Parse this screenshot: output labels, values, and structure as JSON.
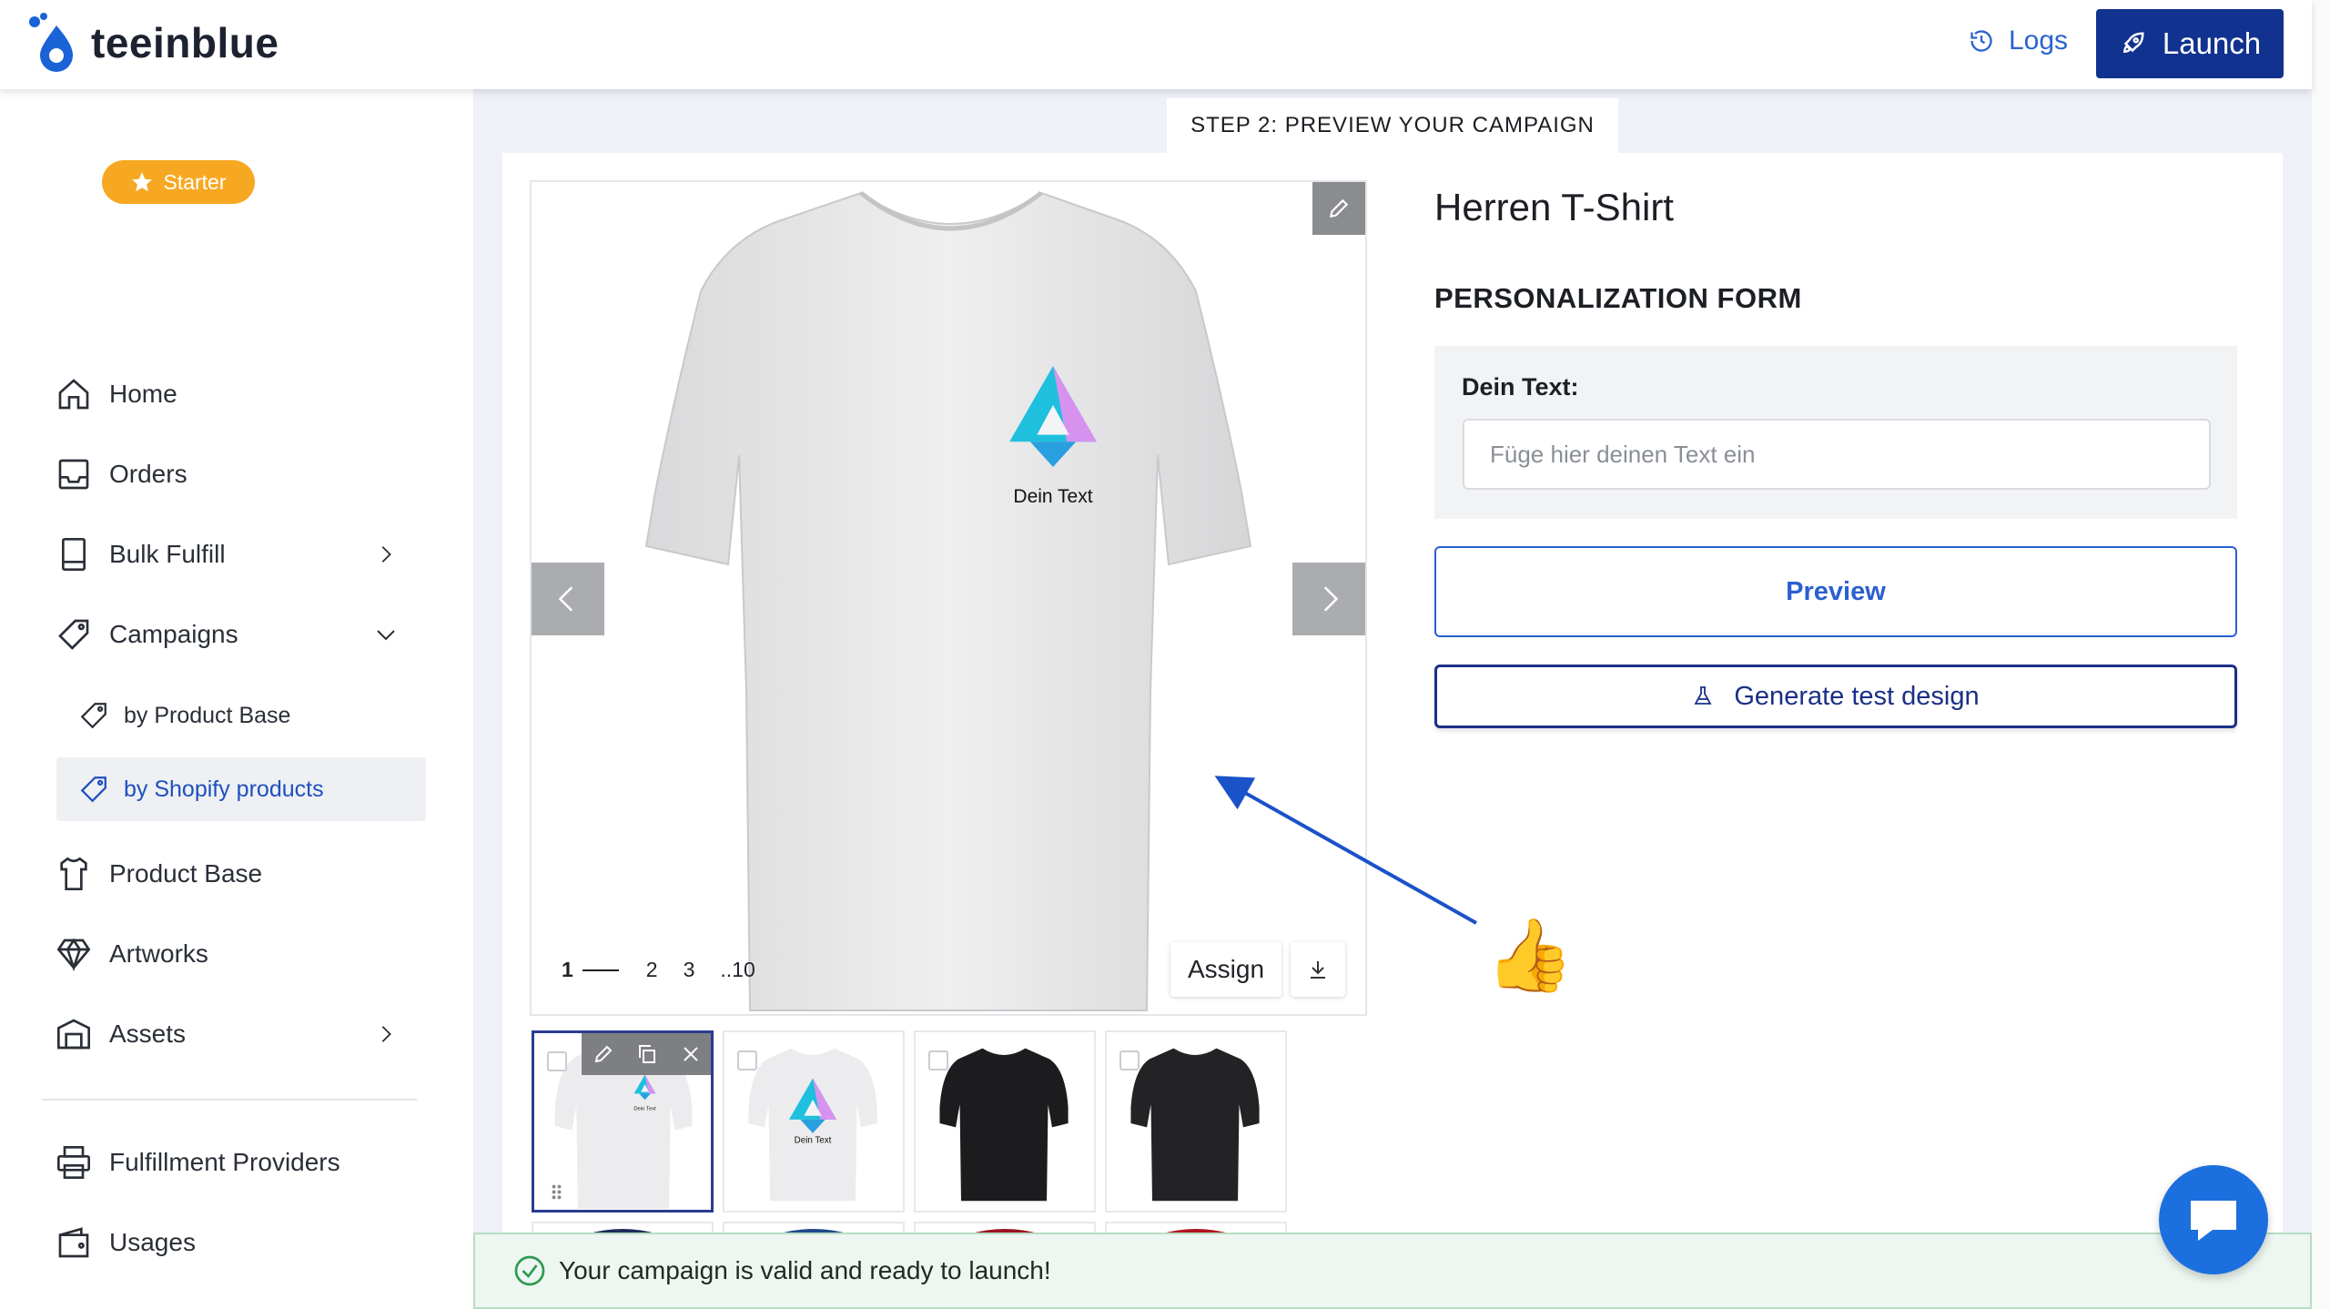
{
  "app": {
    "name": "teeinblue"
  },
  "header": {
    "logs_label": "Logs",
    "launch_label": "Launch"
  },
  "sidebar": {
    "plan_badge": "Starter",
    "items": [
      {
        "label": "Home",
        "icon": "home-icon"
      },
      {
        "label": "Orders",
        "icon": "inbox-icon"
      },
      {
        "label": "Bulk Fulfill",
        "icon": "book-icon"
      },
      {
        "label": "Campaigns",
        "icon": "tag-icon"
      },
      {
        "label": "Product Base",
        "icon": "shirt-icon"
      },
      {
        "label": "Artworks",
        "icon": "diamond-icon"
      },
      {
        "label": "Assets",
        "icon": "warehouse-icon"
      },
      {
        "label": "Fulfillment Providers",
        "icon": "printer-icon"
      },
      {
        "label": "Usages",
        "icon": "wallet-icon"
      }
    ],
    "campaign_sub": [
      {
        "label": "by Product Base",
        "active": false
      },
      {
        "label": "by Shopify products",
        "active": true
      }
    ]
  },
  "step_label": "STEP 2: PREVIEW YOUR CAMPAIGN",
  "preview": {
    "design_text": "Dein Text",
    "pages": [
      "1",
      "2",
      "3",
      "..10"
    ],
    "assign_label": "Assign",
    "thumb_text": "Dein Text"
  },
  "product": {
    "title": "Herren T-Shirt",
    "form_heading": "PERSONALIZATION FORM",
    "field_label": "Dein Text:",
    "field_placeholder": "Füge hier deinen Text ein",
    "field_value": "",
    "preview_label": "Preview",
    "generate_label": "Generate test design"
  },
  "banner": {
    "message": "Your campaign is valid and ready to launch!"
  },
  "colors": {
    "primary": "#11328f",
    "link": "#2b63cc",
    "badge": "#f7a823",
    "success": "#2e9a52",
    "chat": "#1c6fde"
  }
}
